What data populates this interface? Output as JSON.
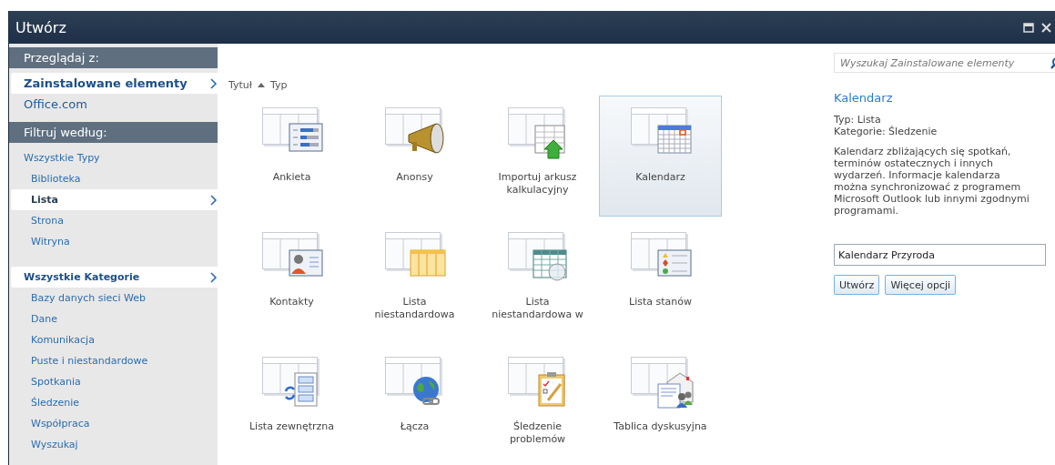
{
  "window": {
    "title": "Utwórz"
  },
  "sidebar": {
    "sections": [
      {
        "heading": "Przeglądaj z:",
        "kind": "sources",
        "items": [
          {
            "label": "Zainstalowane elementy",
            "selected": true
          },
          {
            "label": "Office.com",
            "selected": false
          }
        ]
      },
      {
        "heading": "Filtruj według:",
        "kind": "filters",
        "items": [
          {
            "label": "Wszystkie Typy",
            "selected": false,
            "children": [
              {
                "label": "Biblioteka",
                "selected": false
              },
              {
                "label": "Lista",
                "selected": true
              },
              {
                "label": "Strona",
                "selected": false
              },
              {
                "label": "Witryna",
                "selected": false
              }
            ]
          },
          {
            "label": "Wszystkie Kategorie",
            "selected": true,
            "children": [
              {
                "label": "Bazy danych sieci Web",
                "selected": false
              },
              {
                "label": "Dane",
                "selected": false
              },
              {
                "label": "Komunikacja",
                "selected": false
              },
              {
                "label": "Puste i niestandardowe",
                "selected": false
              },
              {
                "label": "Spotkania",
                "selected": false
              },
              {
                "label": "Śledzenie",
                "selected": false
              },
              {
                "label": "Współpraca",
                "selected": false
              },
              {
                "label": "Wyszukaj",
                "selected": false
              }
            ]
          }
        ]
      }
    ]
  },
  "sort": {
    "options": [
      {
        "label": "Tytuł",
        "selected": true
      },
      {
        "label": "Typ",
        "selected": false
      }
    ]
  },
  "templates": [
    {
      "label": "Ankieta",
      "selected": false
    },
    {
      "label": "Anonsy",
      "selected": false
    },
    {
      "label": "Importuj arkusz kalkulacyjny",
      "selected": false
    },
    {
      "label": "Kalendarz",
      "selected": true
    },
    {
      "label": "Kontakty",
      "selected": false
    },
    {
      "label": "Lista niestandardowa",
      "selected": false
    },
    {
      "label": "Lista niestandardowa w",
      "selected": false
    },
    {
      "label": "Lista stanów",
      "selected": false
    },
    {
      "label": "Lista zewnętrzna",
      "selected": false
    },
    {
      "label": "Łącza",
      "selected": false
    },
    {
      "label": "Śledzenie problemów",
      "selected": false
    },
    {
      "label": "Tablica dyskusyjna",
      "selected": false
    }
  ],
  "details": {
    "search_placeholder": "Wyszukaj Zainstalowane elementy",
    "title": "Kalendarz",
    "type": "Typ: Lista",
    "categories": "Kategorie: Śledzenie",
    "description": "Kalendarz zbliżających się spotkań, terminów ostatecznych i innych wydarzeń. Informacje kalendarza można synchronizować z programem Microsoft Outlook lub innymi zgodnymi programami.",
    "name_value": "Kalendarz Przyroda",
    "buttons": [
      "Utwórz",
      "Więcej opcji"
    ]
  }
}
